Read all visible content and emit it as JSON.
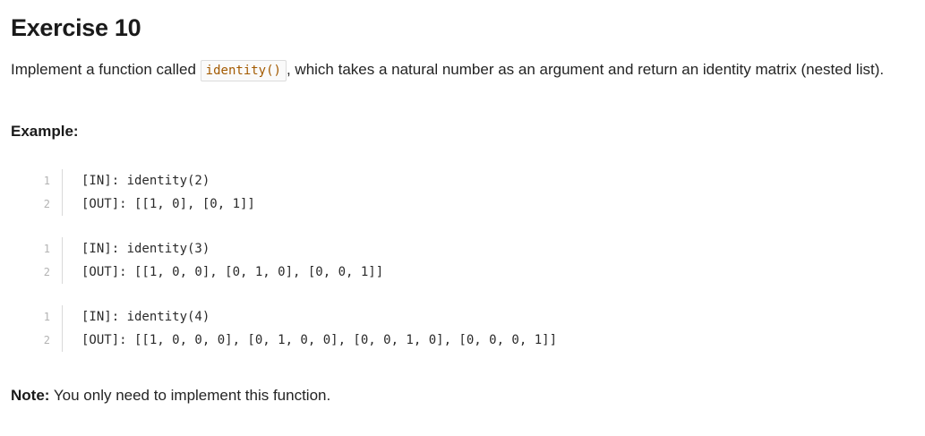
{
  "title": "Exercise 10",
  "intro": {
    "before": "Implement a function called ",
    "code": "identity()",
    "after": ", which takes a natural number as an argument and return an identity matrix (nested list)."
  },
  "example_heading": "Example:",
  "examples": [
    {
      "lines": [
        {
          "num": "1",
          "text": "[IN]: identity(2)"
        },
        {
          "num": "2",
          "text": "[OUT]: [[1, 0], [0, 1]]"
        }
      ]
    },
    {
      "lines": [
        {
          "num": "1",
          "text": "[IN]: identity(3)"
        },
        {
          "num": "2",
          "text": "[OUT]: [[1, 0, 0], [0, 1, 0], [0, 0, 1]]"
        }
      ]
    },
    {
      "lines": [
        {
          "num": "1",
          "text": "[IN]: identity(4)"
        },
        {
          "num": "2",
          "text": "[OUT]: [[1, 0, 0, 0], [0, 1, 0, 0], [0, 0, 1, 0], [0, 0, 0, 1]]"
        }
      ]
    }
  ],
  "note": {
    "label": "Note:",
    "text": " You only need to implement this function."
  }
}
